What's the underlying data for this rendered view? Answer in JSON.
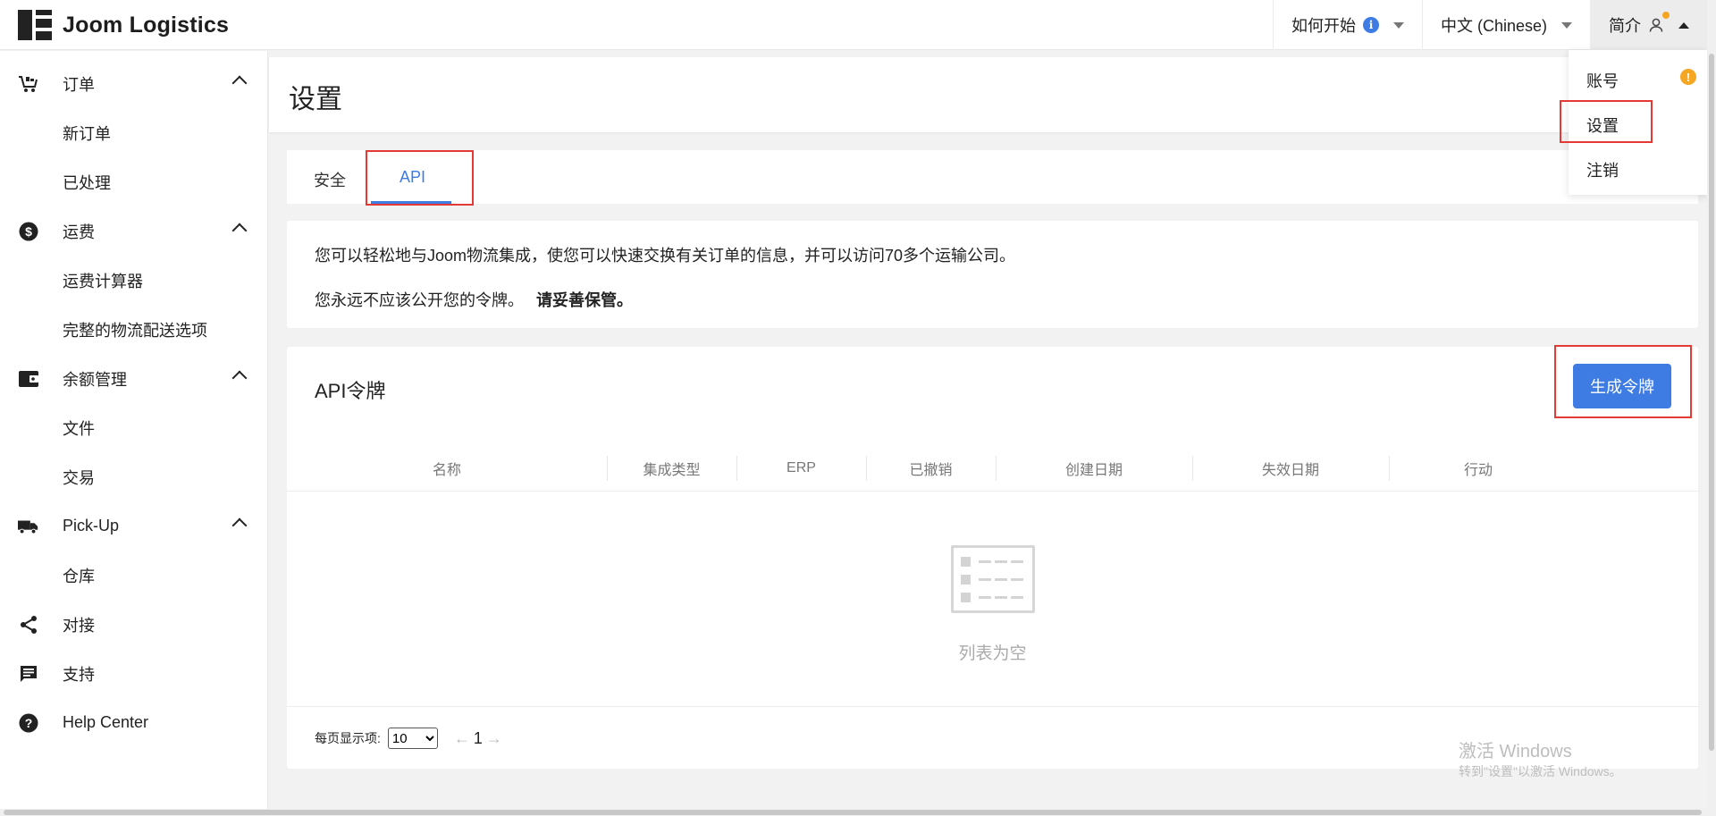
{
  "app": {
    "brand": "Joom Logistics"
  },
  "topnav": {
    "how_to_start": "如何开始",
    "language": "中文 (Chinese)",
    "profile": "简介"
  },
  "profile_menu": {
    "items": [
      {
        "label": "账号",
        "badge": "!"
      },
      {
        "label": "设置"
      },
      {
        "label": "注销"
      }
    ]
  },
  "sidebar": {
    "orders": {
      "label": "订单",
      "children": [
        "新订单",
        "已处理"
      ]
    },
    "shipping": {
      "label": "运费",
      "children": [
        "运费计算器",
        "完整的物流配送选项"
      ]
    },
    "balance": {
      "label": "余额管理",
      "children": [
        "文件",
        "交易"
      ]
    },
    "pickup": {
      "label": "Pick-Up",
      "children": [
        "仓库"
      ]
    },
    "integration": {
      "label": "对接"
    },
    "support": {
      "label": "支持"
    },
    "help": {
      "label": "Help Center"
    }
  },
  "page": {
    "title": "设置",
    "tabs": [
      {
        "label": "安全"
      },
      {
        "label": "API",
        "active": true
      }
    ]
  },
  "info": {
    "line1": "您可以轻松地与Joom物流集成，使您可以快速交换有关订单的信息，并可以访问70多个运输公司。",
    "line2": "您永远不应该公开您的令牌。",
    "line2_bold": "请妥善保管。"
  },
  "tokens": {
    "title": "API令牌",
    "generate_button": "生成令牌",
    "columns": [
      "名称",
      "集成类型",
      "ERP",
      "已撤销",
      "创建日期",
      "失效日期",
      "行动"
    ],
    "empty_text": "列表为空",
    "per_page_label": "每页显示项:",
    "per_page_value": "10",
    "per_page_options": [
      "10"
    ],
    "prev_arrow": "←",
    "page": "1",
    "next_arrow": "→"
  },
  "watermark": {
    "line1": "激活 Windows",
    "line2": "转到\"设置\"以激活 Windows。"
  },
  "colors": {
    "accent": "#3e7ce3",
    "highlight": "#e53935",
    "warning": "#f5a623"
  }
}
